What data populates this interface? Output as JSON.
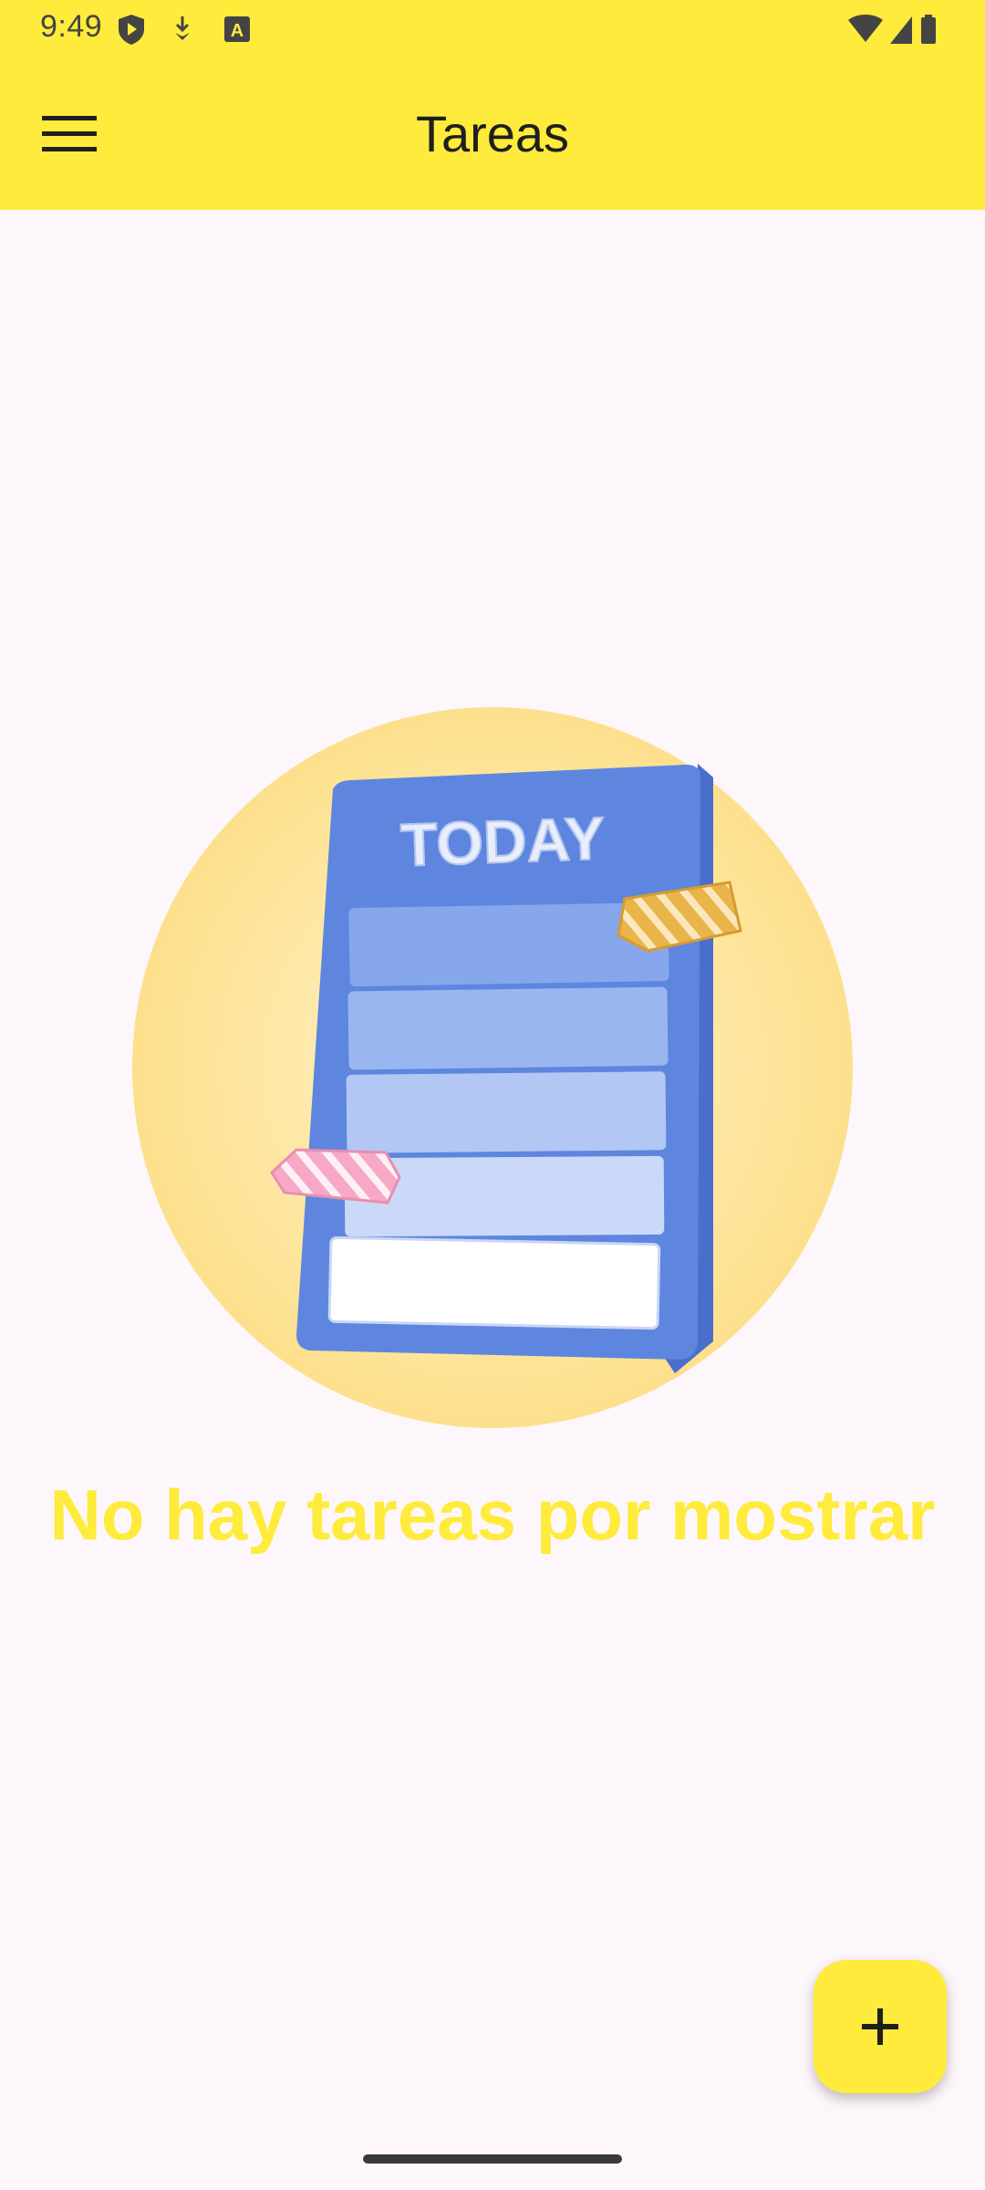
{
  "status_bar": {
    "time": "9:49",
    "left_icons": [
      "shield-play-icon",
      "download-icon",
      "font-a-icon"
    ],
    "right_icons": [
      "wifi-icon",
      "signal-icon",
      "battery-icon"
    ]
  },
  "app_bar": {
    "title": "Tareas",
    "menu_icon": "hamburger-menu-icon",
    "background": "#ffeb3b"
  },
  "empty_state": {
    "illustration_label": "TODAY",
    "message": "No hay tareas por mostrar",
    "message_color": "#ffeb3b"
  },
  "fab": {
    "icon": "plus-icon",
    "background": "#ffeb3b"
  }
}
